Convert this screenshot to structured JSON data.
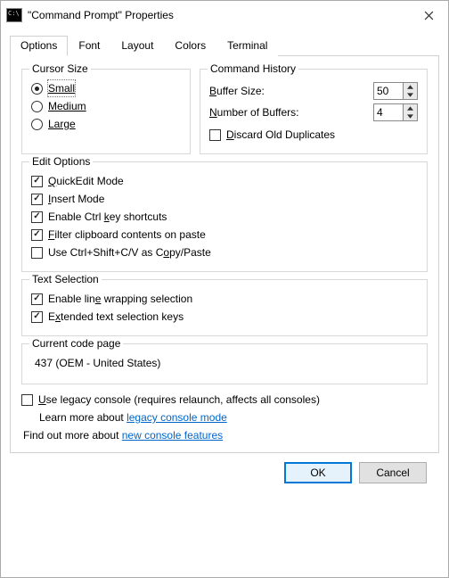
{
  "window": {
    "title": "\"Command Prompt\" Properties"
  },
  "tabs": [
    "Options",
    "Font",
    "Layout",
    "Colors",
    "Terminal"
  ],
  "cursor": {
    "group": "Cursor Size",
    "small": "Small",
    "medium": "Medium",
    "large": "Large"
  },
  "history": {
    "group": "Command History",
    "buffer_label_pre": "B",
    "buffer_label_post": "uffer Size:",
    "buffer_value": "50",
    "num_label_pre": "N",
    "num_label_post": "umber of Buffers:",
    "num_value": "4",
    "discard_pre": "D",
    "discard_post": "iscard Old Duplicates"
  },
  "edit": {
    "group": "Edit Options",
    "quickedit_pre": "Q",
    "quickedit_post": "uickEdit Mode",
    "insert_pre": "I",
    "insert_post": "nsert Mode",
    "ctrlkey_a": "Enable Ctrl ",
    "ctrlkey_u": "k",
    "ctrlkey_b": "ey shortcuts",
    "filter_u": "F",
    "filter_b": "ilter clipboard contents on paste",
    "cscv_a": "Use Ctrl+Shift+C/V as C",
    "cscv_u": "o",
    "cscv_b": "py/Paste"
  },
  "textsel": {
    "group": "Text Selection",
    "wrap_a": "Enable lin",
    "wrap_u": "e",
    "wrap_b": " wrapping selection",
    "ext_a": "E",
    "ext_u": "x",
    "ext_b": "tended text selection keys"
  },
  "codepage": {
    "group": "Current code page",
    "value": "437   (OEM - United States)"
  },
  "legacy": {
    "label_u": "U",
    "label_b": "se legacy console (requires relaunch, affects all consoles)",
    "learn_a": "Learn more about ",
    "learn_link": "legacy console mode"
  },
  "more": {
    "a": "Find out more about ",
    "link": "new console features"
  },
  "buttons": {
    "ok": "OK",
    "cancel": "Cancel"
  }
}
